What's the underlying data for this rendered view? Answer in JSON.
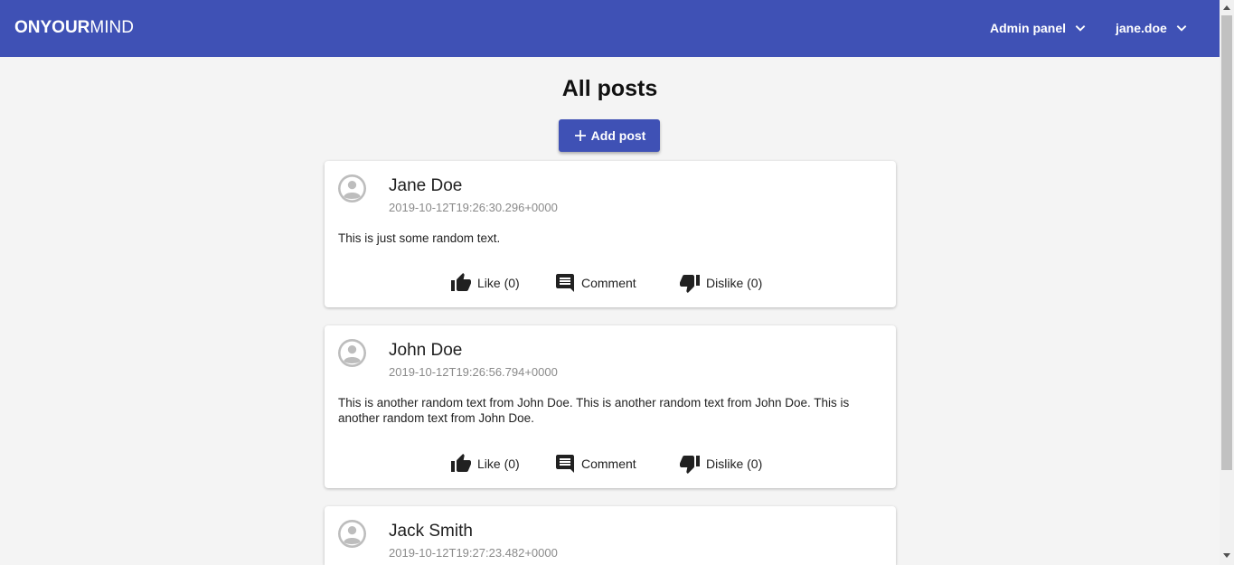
{
  "app": {
    "brand_part1": "ON",
    "brand_part2": "YOUR",
    "brand_part3": "MIND",
    "accent_color": "#3f51b5"
  },
  "nav": {
    "admin_label": "Admin panel",
    "user_label": "jane.doe"
  },
  "main": {
    "title": "All posts",
    "add_post_label": "Add post"
  },
  "posts": [
    {
      "author": "Jane Doe",
      "timestamp": "2019-10-12T19:26:30.296+0000",
      "text": "This is just some random text.",
      "like_label": "Like (0)",
      "comment_label": "Comment",
      "dislike_label": "Dislike (0)"
    },
    {
      "author": "John Doe",
      "timestamp": "2019-10-12T19:26:56.794+0000",
      "text": "This is another random text from John Doe. This is another random text from John Doe. This is another random text from John Doe.",
      "like_label": "Like (0)",
      "comment_label": "Comment",
      "dislike_label": "Dislike (0)"
    },
    {
      "author": "Jack Smith",
      "timestamp": "2019-10-12T19:27:23.482+0000"
    }
  ],
  "icons": {
    "like": "thumb-up-icon",
    "comment": "comment-icon",
    "dislike": "thumb-down-icon",
    "avatar": "account-circle-icon",
    "add": "plus-icon",
    "chevron": "chevron-down-icon"
  }
}
